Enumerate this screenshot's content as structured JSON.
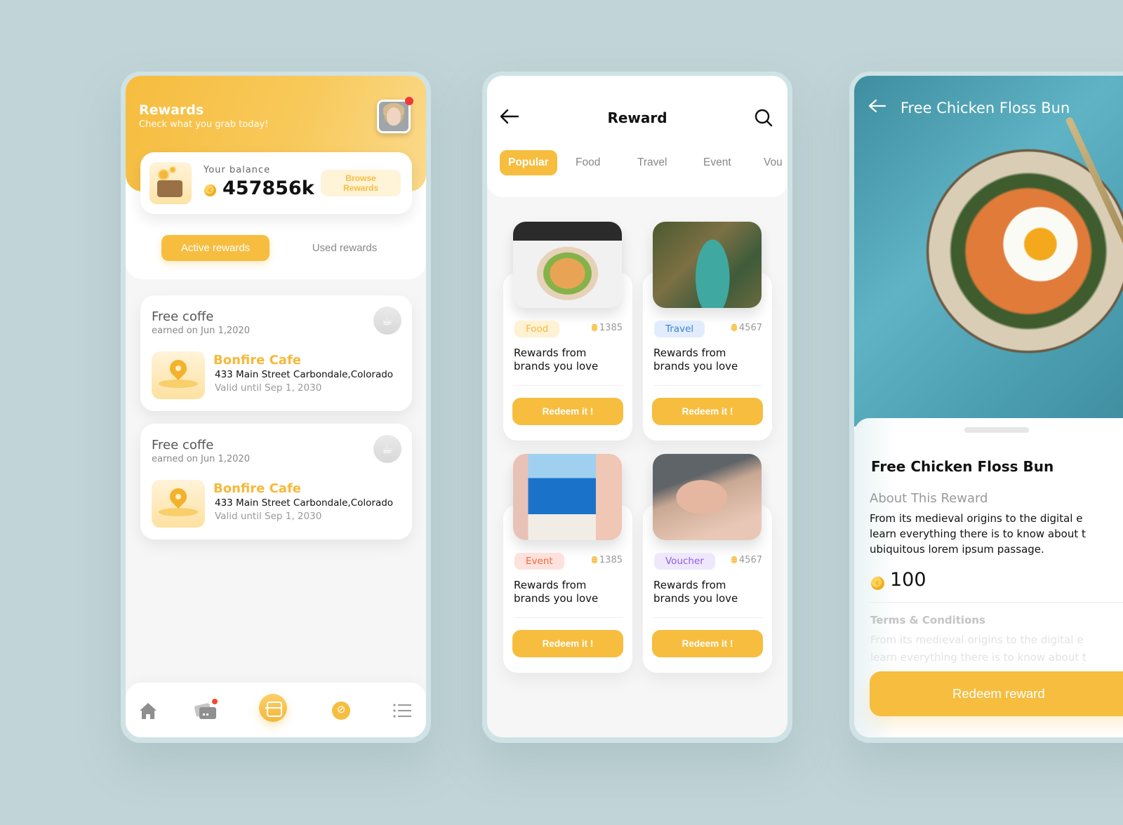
{
  "colors": {
    "accent": "#f6bd3f",
    "background": "#c1d4d7",
    "frame": "#cfe2e5",
    "notification": "#f03a3a"
  },
  "rewards_screen": {
    "title": "Rewards",
    "subtitle": "Check what you grab today!",
    "avatar_icon": "user-avatar",
    "balance": {
      "label": "Your balance",
      "value": "457856k",
      "browse_button": "Browse\nRewards"
    },
    "tabs": [
      {
        "label": "Active rewards",
        "active": true
      },
      {
        "label": "Used rewards",
        "active": false
      }
    ],
    "items": [
      {
        "title": "Free coffe",
        "earned": "earned on Jun 1,2020",
        "place": "Bonfire Cafe",
        "address": "433 Main Street Carbondale,Colorado",
        "valid": "Valid until Sep 1, 2030"
      },
      {
        "title": "Free coffe",
        "earned": "earned on Jun 1,2020",
        "place": "Bonfire Cafe",
        "address": "433 Main Street Carbondale,Colorado",
        "valid": "Valid until Sep 1, 2030"
      }
    ],
    "bottom_nav": [
      {
        "icon": "home-icon"
      },
      {
        "icon": "cards-icon",
        "badge": true
      },
      {
        "icon": "scan-icon",
        "active": true
      },
      {
        "icon": "badge-icon"
      },
      {
        "icon": "menu-icon"
      }
    ]
  },
  "reward_list_screen": {
    "title": "Reward",
    "back_icon": "arrow-left-icon",
    "search_icon": "search-icon",
    "categories": [
      {
        "label": "Popular",
        "active": true
      },
      {
        "label": "Food"
      },
      {
        "label": "Travel"
      },
      {
        "label": "Event"
      },
      {
        "label": "Vou"
      }
    ],
    "cards": [
      {
        "tag": "Food",
        "tag_bg": "#fff1d4",
        "tag_color": "#f6b93a",
        "points": "1385",
        "title": "Rewards from\nbrands you love",
        "button": "Redeem it !",
        "image": "food-bowl"
      },
      {
        "tag": "Travel",
        "tag_bg": "#e1edfd",
        "tag_color": "#3e7fd6",
        "points": "4567",
        "title": "Rewards from\nbrands you love",
        "button": "Redeem it !",
        "image": "river-palms"
      },
      {
        "tag": "Event",
        "tag_bg": "#fde1dc",
        "tag_color": "#ef6a3a",
        "points": "1385",
        "title": "Rewards from\nbrands you love",
        "button": "Redeem it !",
        "image": "santorini-sea"
      },
      {
        "tag": "Voucher",
        "tag_bg": "#efe8fd",
        "tag_color": "#8b5de0",
        "points": "4567",
        "title": "Rewards from\nbrands you love",
        "button": "Redeem it !",
        "image": "massage"
      }
    ]
  },
  "detail_screen": {
    "hero_title": "Free Chicken Floss Bun",
    "title": "Free Chicken Floss Bun",
    "about_label": "About This Reward",
    "about_lines": [
      "From its medieval origins to the digital e",
      "learn everything there is to know about t",
      "ubiquitous lorem ipsum passage."
    ],
    "price": "100",
    "terms_label": "Terms & Conditions",
    "terms_lines": [
      "From its medieval origins to the digital e",
      "learn everything there is to know about t"
    ],
    "redeem_button": "Redeem reward"
  }
}
